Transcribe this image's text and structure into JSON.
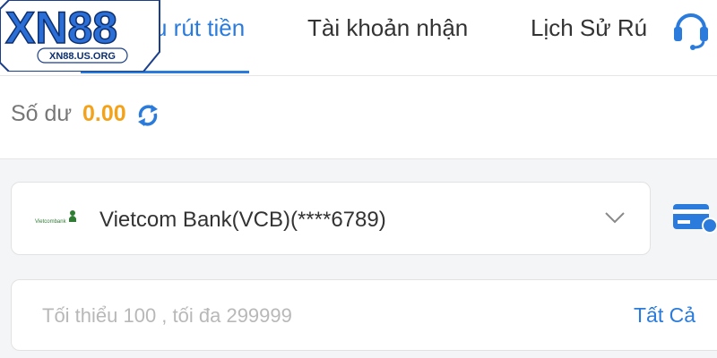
{
  "logo": {
    "brand": "XN88",
    "url": "XN88.US.ORG"
  },
  "tabs": [
    {
      "label": "u rút tiền",
      "active": true
    },
    {
      "label": "Tài khoản nhận",
      "active": false
    },
    {
      "label": "Lịch Sử Rú",
      "active": false
    }
  ],
  "balance": {
    "label": "Số dư",
    "value": "0.00"
  },
  "bank": {
    "logo_text": "Vietcombank",
    "selected": "Vietcom Bank(VCB)(****6789)"
  },
  "amount": {
    "placeholder": "Tối thiểu 100 , tối đa 299999",
    "all_label": "Tất Cả"
  },
  "colors": {
    "accent": "#2a7bdc",
    "balance": "#f3a21a",
    "logo_blue": "#2b6fd6",
    "vcb_green": "#2e7d32"
  }
}
